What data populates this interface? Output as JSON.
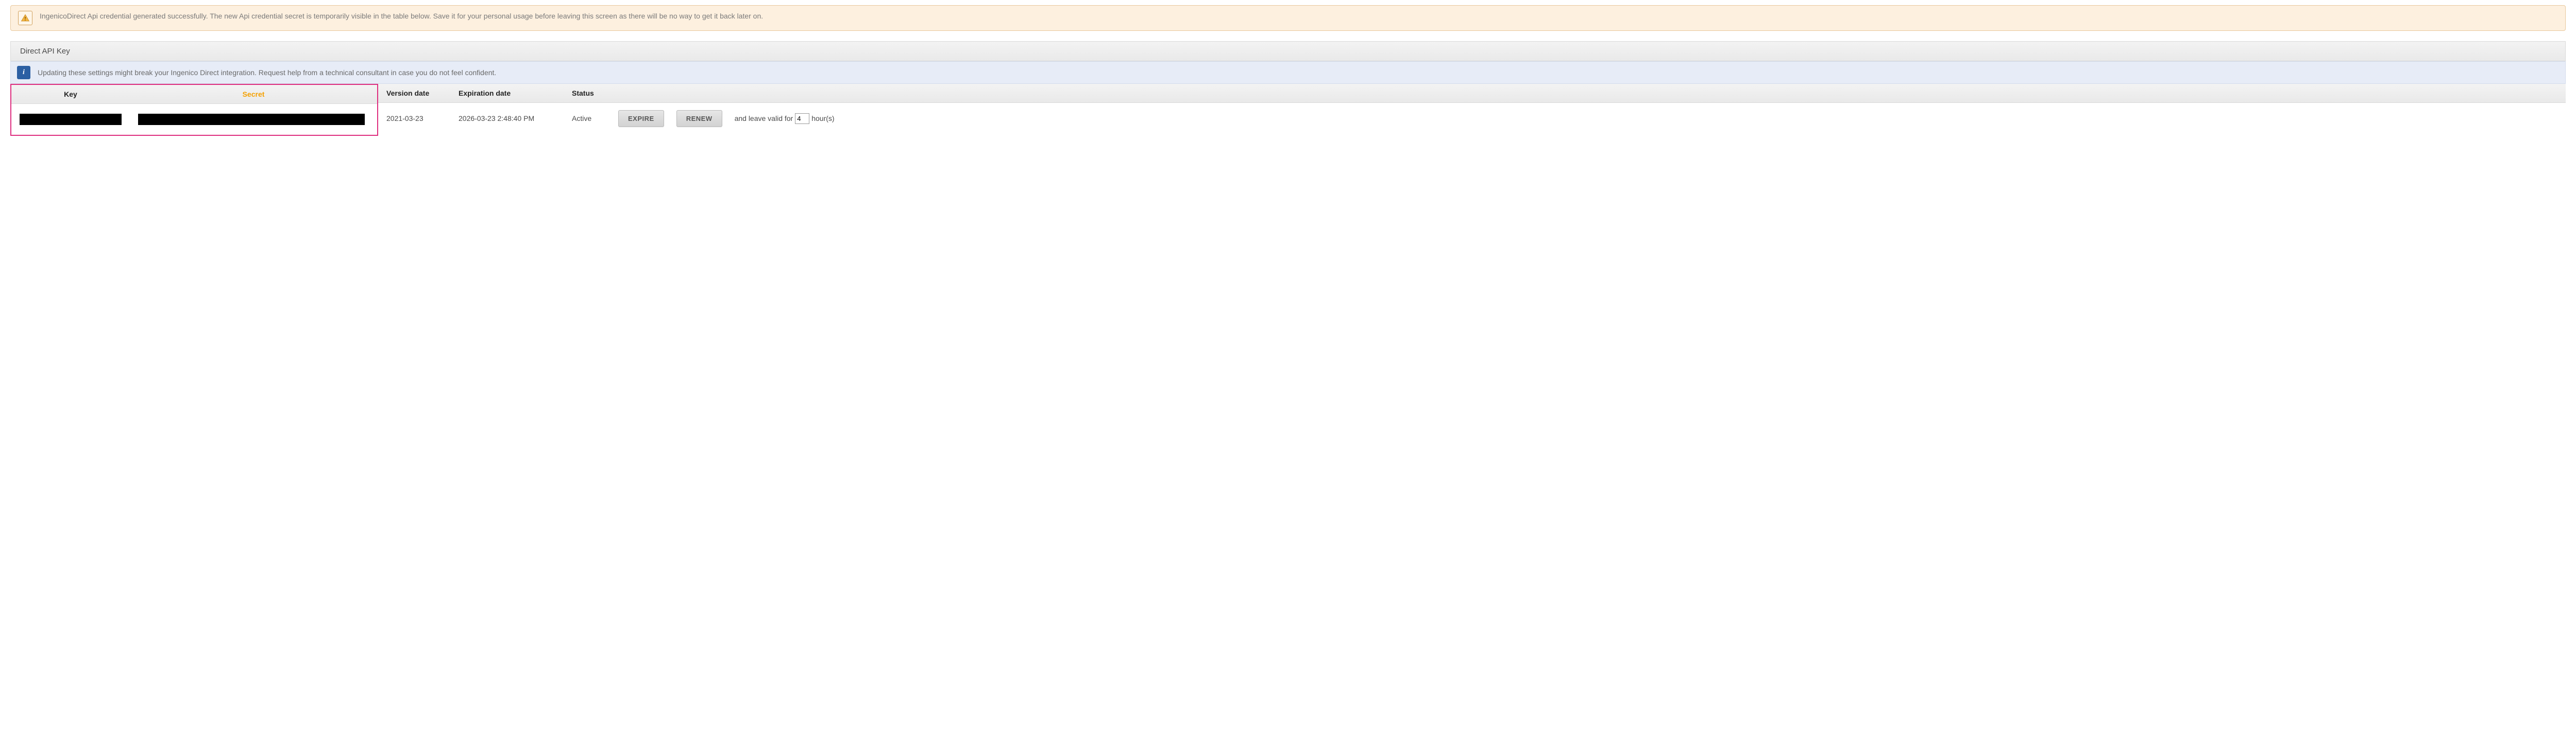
{
  "alert_warning": {
    "text": "IngenicoDirect Api credential generated successfully. The new Api credential secret is temporarily visible in the table below. Save it for your personal usage before leaving this screen as there will be no way to get it back later on."
  },
  "panel": {
    "title": "Direct API Key"
  },
  "alert_info": {
    "text": "Updating these settings might break your Ingenico Direct integration. Request help from a technical consultant in case you do not feel confident."
  },
  "table": {
    "headers": {
      "key": "Key",
      "secret": "Secret",
      "version_date": "Version date",
      "expiration_date": "Expiration date",
      "status": "Status"
    },
    "row": {
      "version_date": "2021-03-23",
      "expiration_date": "2026-03-23 2:48:40 PM",
      "status": "Active"
    },
    "actions": {
      "expire_label": "EXPIRE",
      "renew_label": "RENEW",
      "leave_valid_prefix": "and leave valid for",
      "leave_valid_suffix": "hour(s)",
      "hours_value": "4"
    }
  }
}
